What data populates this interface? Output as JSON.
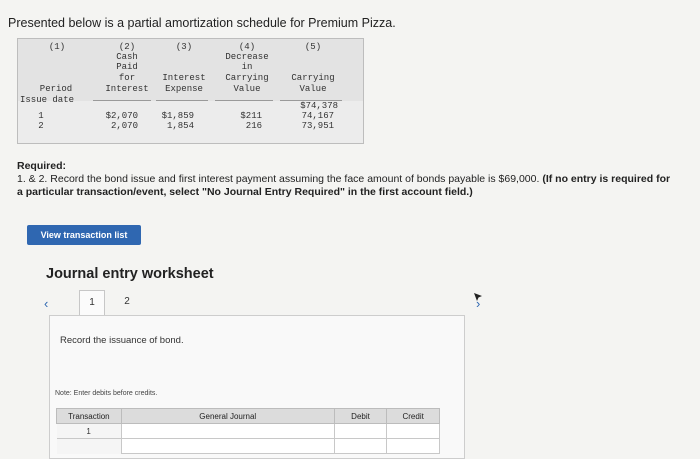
{
  "intro": "Presented below is a partial amortization schedule for Premium Pizza.",
  "table": {
    "col_numbers": [
      "(1)",
      "(2)",
      "(3)",
      "(4)",
      "(5)"
    ],
    "col2_header": [
      "Cash",
      "Paid",
      "for",
      "Interest"
    ],
    "col3_header": [
      "Interest",
      "Expense"
    ],
    "col4_header": [
      "Decrease",
      "in",
      "Carrying",
      "Value"
    ],
    "col5_header": [
      "Carrying",
      "Value"
    ],
    "col1_header": "Period",
    "rows": [
      {
        "period": "Issue date",
        "cash": "",
        "interest": "",
        "decrease": "",
        "carrying": "$74,378"
      },
      {
        "period": "1",
        "cash": "$2,070",
        "interest": "$1,859",
        "decrease": "$211",
        "carrying": "74,167"
      },
      {
        "period": "2",
        "cash": "2,070",
        "interest": "1,854",
        "decrease": "216",
        "carrying": "73,951"
      }
    ]
  },
  "required": {
    "title": "Required:",
    "text": "1. & 2. Record the bond issue and first interest payment assuming the face amount of bonds payable is $69,000.",
    "bold_note": "(If no entry is required for a particular transaction/event, select \"No Journal Entry Required\" in the first account field.)"
  },
  "view_button": "View transaction list",
  "worksheet": {
    "title": "Journal entry worksheet",
    "tabs": [
      "1",
      "2"
    ],
    "active_tab": "1",
    "instruction": "Record the issuance of bond.",
    "note": "Note: Enter debits before credits.",
    "columns": [
      "Transaction",
      "General Journal",
      "Debit",
      "Credit"
    ],
    "rows": [
      {
        "transaction": "1"
      }
    ]
  },
  "colors": {
    "accent": "#2f67b1",
    "background": "#f4f4f2"
  }
}
